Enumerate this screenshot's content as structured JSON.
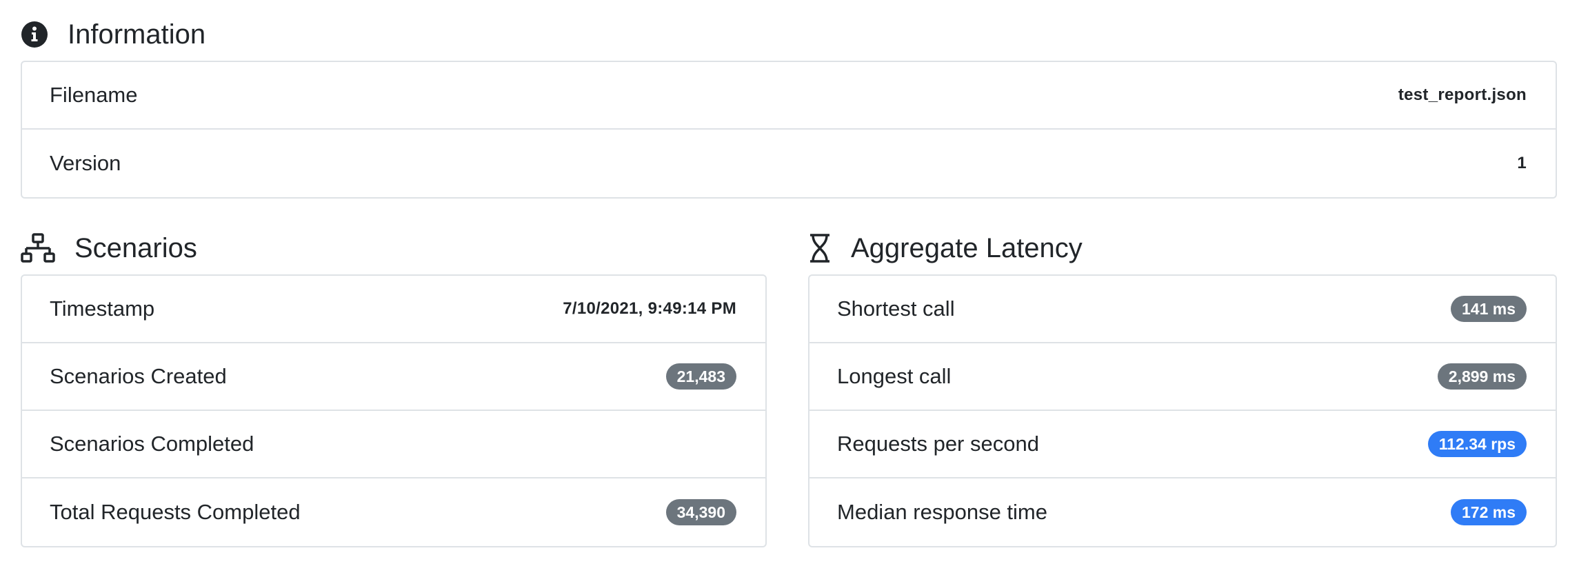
{
  "information": {
    "title": "Information",
    "icon": "info-circle-icon",
    "rows": [
      {
        "label": "Filename",
        "value": "test_report.json"
      },
      {
        "label": "Version",
        "value": "1"
      }
    ]
  },
  "scenarios": {
    "title": "Scenarios",
    "icon": "network-icon",
    "timestamp_label": "Timestamp",
    "timestamp_value": "7/10/2021, 9:49:14 PM",
    "created_label": "Scenarios Created",
    "created_value": "21,483",
    "completed_label": "Scenarios Completed",
    "total_label": "Total Requests Completed",
    "total_value": "34,390"
  },
  "latency": {
    "title": "Aggregate Latency",
    "icon": "hourglass-icon",
    "rows": [
      {
        "label": "Shortest call",
        "value": "141 ms",
        "color": "#6c757d"
      },
      {
        "label": "Longest call",
        "value": "2,899 ms",
        "color": "#6c757d"
      },
      {
        "label": "Requests per second",
        "value": "112.34 rps",
        "color": "#2f7cf6"
      },
      {
        "label": "Median response time",
        "value": "172 ms",
        "color": "#2f7cf6"
      }
    ]
  }
}
